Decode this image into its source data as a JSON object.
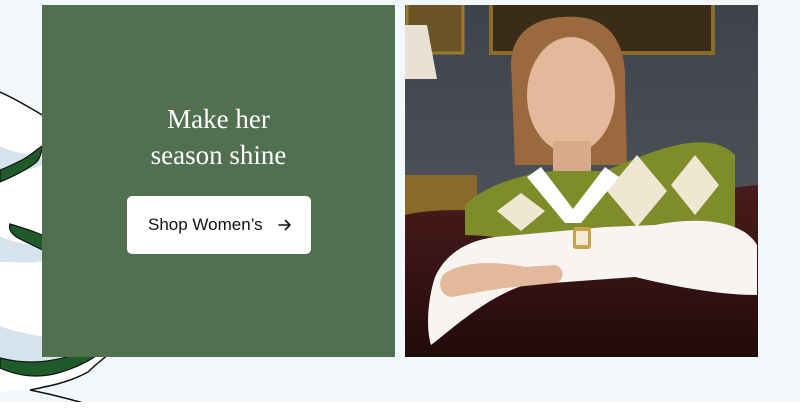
{
  "promo": {
    "headline_line1": "Make her",
    "headline_line2": "season shine",
    "cta_label": "Shop Women’s"
  },
  "icons": {
    "cta_icon": "arrow-right-icon"
  },
  "colors": {
    "panel_green": "#51704f",
    "page_background": "#f1f7fb",
    "button_background": "#ffffff",
    "tree_green": "#1f5a2a",
    "snow_shadow": "#d6e3ec"
  }
}
